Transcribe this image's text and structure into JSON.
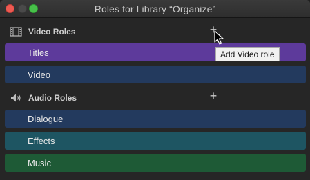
{
  "window": {
    "title": "Roles for Library “Organize”"
  },
  "video_section": {
    "label": "Video Roles",
    "icon": "film-icon",
    "add_label": "+",
    "roles": [
      {
        "label": "Titles",
        "color": "#5d3a9b"
      },
      {
        "label": "Video",
        "color": "#233a5e"
      }
    ]
  },
  "audio_section": {
    "label": "Audio Roles",
    "icon": "speaker-icon",
    "add_label": "+",
    "roles": [
      {
        "label": "Dialogue",
        "color": "#233a5e"
      },
      {
        "label": "Effects",
        "color": "#1e5562"
      },
      {
        "label": "Music",
        "color": "#1e5a36"
      }
    ]
  },
  "tooltip": {
    "text": "Add Video role"
  }
}
